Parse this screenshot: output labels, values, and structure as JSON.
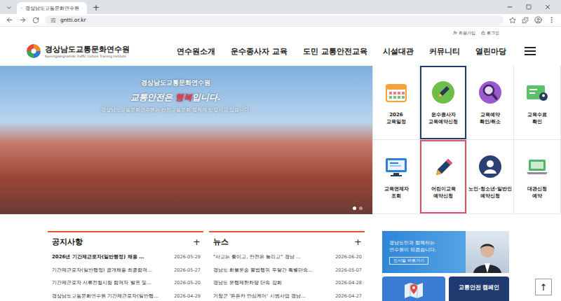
{
  "browser": {
    "tab_title": "경상남도교통문화연수원",
    "new_tab": "+",
    "url": "gntti.or.kr"
  },
  "util_links": [
    "회원가입",
    "로그인"
  ],
  "logo": {
    "name": "경상남도교통문화연수원",
    "subtitle": "Gyeongsangnamdo Traffic Culture Training Institute"
  },
  "nav": [
    "연수원소개",
    "운수종사자 교육",
    "도민 교통안전교육",
    "시설대관",
    "커뮤니티",
    "열린마당"
  ],
  "banner": {
    "title": "경상남도교통문화연수원",
    "slogan": [
      {
        "text": "교통안전은 ",
        "color": "#ffffff"
      },
      {
        "text": "행복",
        "color": "#e8344b"
      },
      {
        "text": "입니다.",
        "color": "#ffffff"
      }
    ],
    "caption": "경상남도교통문화연수원은 선진교통문화 정착에 앞장서고 있습니다.",
    "dots": [
      {
        "selected": true
      },
      {
        "selected": false
      }
    ]
  },
  "quick_menu": [
    {
      "lines": [
        "2026",
        "교육일정"
      ],
      "kind": "calendar",
      "highlighted": false,
      "color": "#e6e6e6"
    },
    {
      "lines": [
        "운수종사자",
        "교육예약신청"
      ],
      "kind": "edit",
      "highlighted": true,
      "color": "#1f3f6e"
    },
    {
      "lines": [
        "교육예약",
        "확인/취소"
      ],
      "kind": "search",
      "highlighted": false,
      "color": "#e6e6e6"
    },
    {
      "lines": [
        "교육수료",
        "확인"
      ],
      "kind": "card",
      "highlighted": false,
      "color": "#e6e6e6"
    },
    {
      "lines": [
        "교육면제자",
        "조회"
      ],
      "kind": "monitor",
      "highlighted": false,
      "color": "#e6e6e6"
    },
    {
      "lines": [
        "어린이교육",
        "예약신청"
      ],
      "kind": "pencil",
      "highlighted": true,
      "color": "#e0526b"
    },
    {
      "lines": [
        "노인·청소년·일반인",
        "예약신청"
      ],
      "kind": "person",
      "highlighted": false,
      "color": "#e6e6e6"
    },
    {
      "lines": [
        "대관신청",
        "예약"
      ],
      "kind": "laptop",
      "highlighted": false,
      "color": "#e6e6e6"
    }
  ],
  "notice": {
    "title": "공지사항",
    "more": "+",
    "rows": [
      {
        "title": "2026년 기간제근로자(일반행정) 채용 …",
        "date": "2026-05-29",
        "bold": true
      },
      {
        "title": "기간제근로자(일반행정) 공개채용 최종합격…",
        "date": "2026-05-27",
        "bold": false
      },
      {
        "title": "기간제근로자 서류전형시험 합격자 발표 및…",
        "date": "2026-05-20",
        "bold": false
      },
      {
        "title": "경상남도교통문화연수원 기간제근로자(일반행…",
        "date": "2026-04-29",
        "bold": false
      }
    ]
  },
  "news": {
    "title": "뉴스",
    "more": "+",
    "rows": [
      {
        "title": "\"사고는 줄이고, 안전은 늘리고\" 경남 …",
        "date": "2026-06-20",
        "bold": false
      },
      {
        "title": "경남도 화물운송 불법행위 두달간 특별단속…",
        "date": "2026-05-07",
        "bold": false
      },
      {
        "title": "경남도 운행제한차량 단속 강화",
        "date": "2026-04-28",
        "bold": false
      },
      {
        "title": "거창군 '든든카 안심케어' 시범사업 경남…",
        "date": "2026-04-27",
        "bold": false
      }
    ]
  },
  "promo": {
    "lines": [
      "경남도민과 함께하는",
      "연수원이 되겠습니다."
    ],
    "button": "인사말 바로가기"
  },
  "campaign": {
    "label": "교통안전 캠페인"
  },
  "top_button": "↑"
}
